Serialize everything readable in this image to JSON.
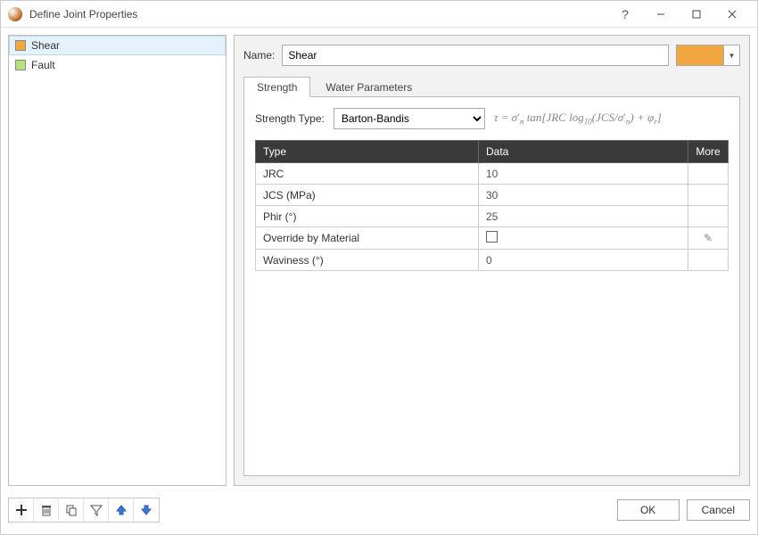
{
  "window": {
    "title": "Define Joint Properties"
  },
  "joints": [
    {
      "name": "Shear",
      "color": "#f2a640",
      "selected": true
    },
    {
      "name": "Fault",
      "color": "#b7e07e",
      "selected": false
    }
  ],
  "name_label": "Name:",
  "name_value": "Shear",
  "selected_color": "#f2a640",
  "tabs": [
    {
      "id": "strength",
      "label": "Strength",
      "active": true
    },
    {
      "id": "water",
      "label": "Water Parameters",
      "active": false
    }
  ],
  "strength": {
    "type_label": "Strength Type:",
    "type_value": "Barton-Bandis",
    "formula_plain": "τ = σ'n tan[JRC log10(JCS/σ'n) + φr]",
    "table": {
      "headers": {
        "type": "Type",
        "data": "Data",
        "more": "More"
      },
      "rows": [
        {
          "type": "JRC",
          "data": "10",
          "more": ""
        },
        {
          "type": "JCS (MPa)",
          "data": "30",
          "more": ""
        },
        {
          "type": "Phir (°)",
          "data": "25",
          "more": ""
        },
        {
          "type": "Override by Material",
          "data_kind": "checkbox",
          "data_checked": false,
          "more": "edit"
        },
        {
          "type": "Waviness (°)",
          "data": "0",
          "more": ""
        }
      ]
    }
  },
  "toolbar_icons": [
    "add",
    "delete",
    "copy",
    "filter",
    "move-up",
    "move-down"
  ],
  "buttons": {
    "ok": "OK",
    "cancel": "Cancel"
  }
}
